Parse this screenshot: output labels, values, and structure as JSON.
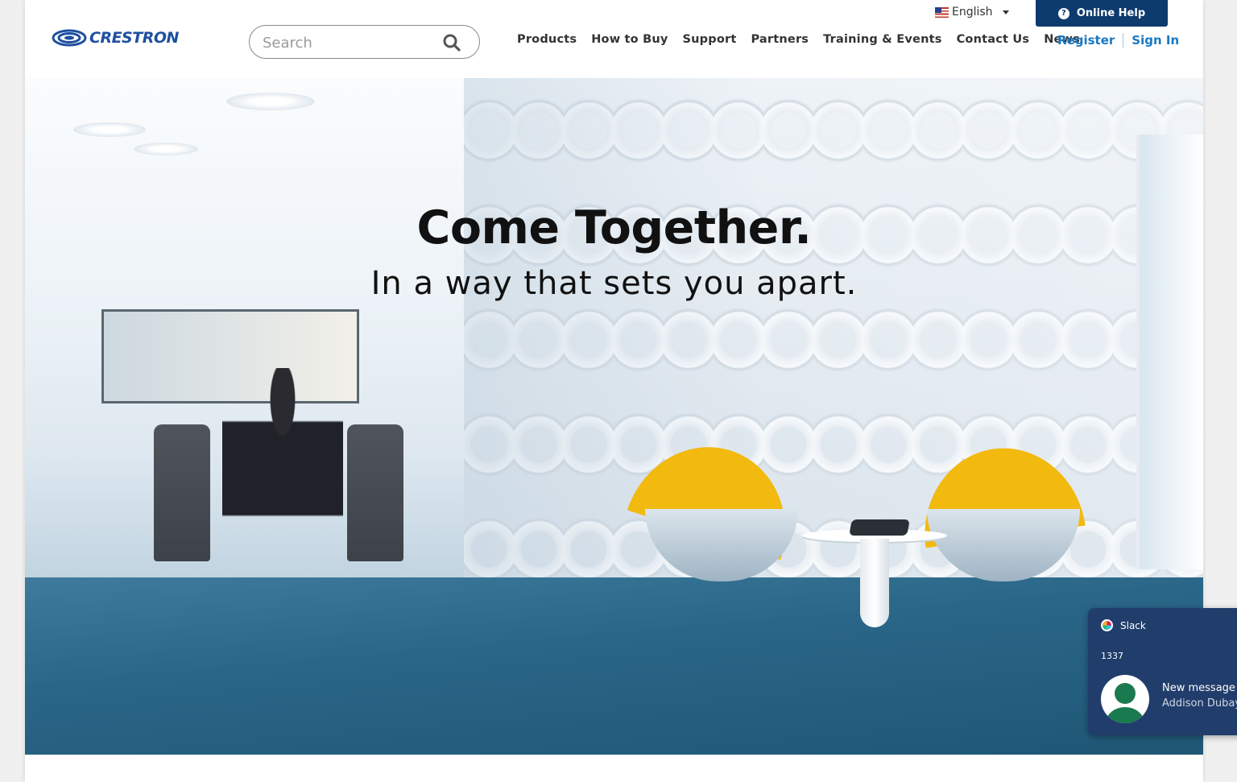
{
  "header": {
    "brand": "CRESTRON",
    "search": {
      "placeholder": "Search"
    },
    "language": "English",
    "online_help": "Online Help",
    "nav": [
      "Products",
      "How to Buy",
      "Support",
      "Partners",
      "Training & Events",
      "Contact Us",
      "News"
    ],
    "register": "Register",
    "sign_in": "Sign In"
  },
  "hero": {
    "title": "Come Together.",
    "subtitle": "In a way that sets you apart."
  },
  "notification": {
    "app": "Slack",
    "count": "1337",
    "message": "New message i",
    "sender": "Addison Dubay"
  },
  "colors": {
    "brand_blue": "#1e4fa0",
    "help_bg": "#0d3b6e",
    "link_blue": "#1a78c2",
    "toast_bg": "#213d6b",
    "accent_yellow": "#f2b90f"
  },
  "icons": {
    "search": "search-icon",
    "help": "question-circle-icon",
    "flag": "us-flag-icon",
    "dropdown": "caret-down-icon",
    "slack": "slack-icon",
    "avatar": "user-avatar-icon"
  }
}
